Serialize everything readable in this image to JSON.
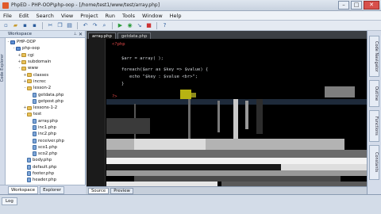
{
  "window": {
    "title": "PhpED - PHP-OOP\\php-oop - [/home/test1/www/test/array.php]",
    "buttons": [
      "–",
      "□",
      "✕"
    ]
  },
  "menubar": [
    "File",
    "Edit",
    "Search",
    "View",
    "Project",
    "Run",
    "Tools",
    "Window",
    "Help"
  ],
  "toolbar": {
    "icons": [
      "new-file-icon",
      "open-folder-icon",
      "save-icon",
      "save-all-icon",
      "cut-icon",
      "copy-icon",
      "paste-icon",
      "undo-icon",
      "redo-icon",
      "find-icon",
      "run-icon",
      "debug-icon",
      "step-icon",
      "stop-icon",
      "help-icon"
    ]
  },
  "workspace": {
    "header": "Workspace",
    "sidebar_tab": "Code Explorer",
    "tree": [
      {
        "label": "PHP-OOP",
        "level": 0,
        "type": "proj",
        "twisty": "-"
      },
      {
        "label": "php-oop",
        "level": 1,
        "type": "proj",
        "twisty": "-"
      },
      {
        "label": "cgi",
        "level": 2,
        "type": "folder",
        "twisty": "+"
      },
      {
        "label": "subdomain",
        "level": 2,
        "type": "folder",
        "twisty": "+"
      },
      {
        "label": "www",
        "level": 2,
        "type": "folder",
        "twisty": "-"
      },
      {
        "label": "classes",
        "level": 3,
        "type": "folder",
        "twisty": "+"
      },
      {
        "label": "increc",
        "level": 3,
        "type": "folder",
        "twisty": "+"
      },
      {
        "label": "lesson-2",
        "level": 3,
        "type": "folder",
        "twisty": "-"
      },
      {
        "label": "getdata.php",
        "level": 4,
        "type": "file",
        "twisty": ""
      },
      {
        "label": "getpost.php",
        "level": 4,
        "type": "file",
        "twisty": ""
      },
      {
        "label": "lessons-1-2",
        "level": 3,
        "type": "folder",
        "twisty": "+"
      },
      {
        "label": "test",
        "level": 3,
        "type": "folder",
        "twisty": "-"
      },
      {
        "label": "array.php",
        "level": 4,
        "type": "file",
        "twisty": ""
      },
      {
        "label": "inc1.php",
        "level": 4,
        "type": "file",
        "twisty": ""
      },
      {
        "label": "inc2.php",
        "level": 4,
        "type": "file",
        "twisty": ""
      },
      {
        "label": "receiver.php",
        "level": 4,
        "type": "file",
        "twisty": ""
      },
      {
        "label": "sco1.php",
        "level": 4,
        "type": "file",
        "twisty": ""
      },
      {
        "label": "sco2.php",
        "level": 4,
        "type": "file",
        "twisty": ""
      },
      {
        "label": "body.php",
        "level": 3,
        "type": "file",
        "twisty": ""
      },
      {
        "label": "default.php",
        "level": 3,
        "type": "file",
        "twisty": ""
      },
      {
        "label": "footer.php",
        "level": 3,
        "type": "file",
        "twisty": ""
      },
      {
        "label": "header.php",
        "level": 3,
        "type": "file",
        "twisty": ""
      }
    ],
    "tabs": [
      "Workspace",
      "Explorer"
    ]
  },
  "editor": {
    "tabs": [
      "array.php",
      "getdata.php"
    ],
    "code": [
      "<?php",
      "$arr = array( );",
      "foreach($arr as $key => $value) {",
      "echo \"$key : $value <br>\";",
      "}",
      "?>"
    ],
    "bottom_tabs": [
      "Source",
      "Preview"
    ]
  },
  "right_panel": {
    "tabs": [
      "Code Navigator",
      "Outline",
      "Functions",
      "Constants"
    ]
  },
  "statusbar": {
    "log_tab": "Log",
    "text": ""
  }
}
